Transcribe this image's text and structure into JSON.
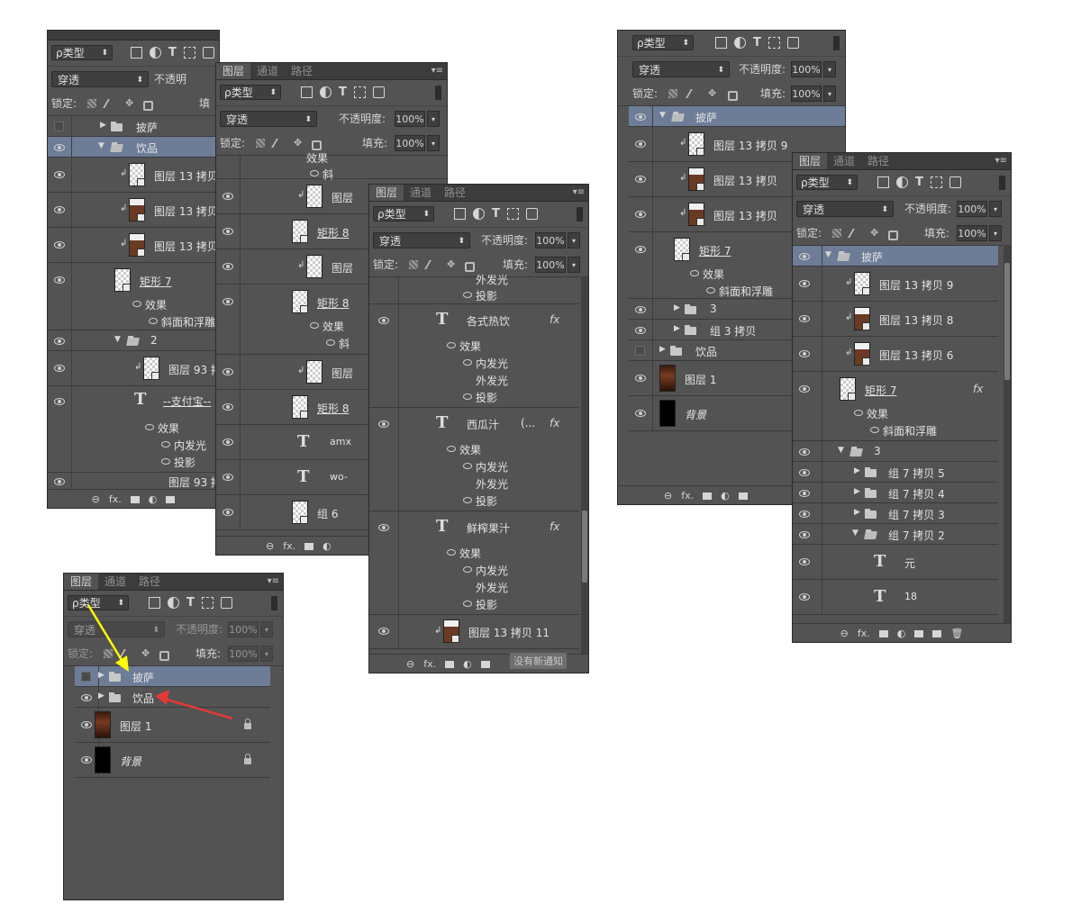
{
  "common": {
    "tab_layers": "图层",
    "tab_channels": "通道",
    "tab_paths": "路径",
    "menu": "▾≡",
    "filter_kind": "ρ类型",
    "blend_mode": "穿透",
    "opacity_label": "不透明度:",
    "opacity_value": "100%",
    "lock_label": "锁定:",
    "fill_label": "填充:",
    "fill_value": "100%",
    "fx": "fx",
    "fx_bottom": "fx."
  },
  "panel1": {
    "opacity_label_cut": "不透明",
    "fill_label_cut": "填",
    "layers": {
      "pizza": "披萨",
      "drinks": "饮品",
      "copy1": "图层 13 拷贝",
      "copy2": "图层 13 拷贝",
      "copy3": "图层 13 拷贝",
      "rect7": "矩形 7",
      "effect": "效果",
      "bevel": "斜面和浮雕",
      "group2": "2",
      "l93": "图层 93 拷",
      "alipay": "--支付宝--",
      "effect2": "效果",
      "inner_glow": "内发光",
      "shadow": "投影",
      "bottom_cut": "图层 93 拷"
    }
  },
  "panel2": {
    "layers": {
      "effect_top": "效果",
      "bevel_top": "斜",
      "l1": "图层",
      "rect8a": "矩形 8",
      "l2": "图层",
      "rect8b": "矩形 8",
      "effect": "效果",
      "bevel": "斜",
      "l3": "图层",
      "rect8c": "矩形 8",
      "amx": "amx",
      "wo": "wo-",
      "group6": "组 6"
    }
  },
  "panel3": {
    "layers": {
      "outer_glow_top": "外发光",
      "shadow_top": "投影",
      "hot_drinks": "各式热饮",
      "effect1": "效果",
      "inner_glow1": "内发光",
      "outer_glow1": "外发光",
      "shadow1": "投影",
      "watermelon": "西瓜汁",
      "watermelon_suffix": "(...",
      "effect2": "效果",
      "inner_glow2": "内发光",
      "outer_glow2": "外发光",
      "shadow2": "投影",
      "fresh_juice": "鲜榨果汁",
      "effect3": "效果",
      "inner_glow3": "内发光",
      "outer_glow3": "外发光",
      "shadow3": "投影",
      "copy11": "图层 13 拷贝 11"
    },
    "notice": "没有新通知"
  },
  "panel4": {
    "layers": {
      "pizza": "披萨",
      "copy9": "图层 13 拷贝 9",
      "copyb": "图层 13 拷贝",
      "copyc": "图层 13 拷贝",
      "rect7": "矩形 7",
      "effect": "效果",
      "bevel": "斜面和浮雕",
      "group3": "3",
      "g3copy": "组 3 拷贝",
      "drinks": "饮品",
      "layer1": "图层 1",
      "background": "背景"
    }
  },
  "panel5": {
    "layers": {
      "pizza": "披萨",
      "copy9": "图层 13 拷贝 9",
      "copy8": "图层 13 拷贝 8",
      "copy6": "图层 13 拷贝 6",
      "rect7": "矩形 7",
      "effect": "效果",
      "bevel": "斜面和浮雕",
      "group3": "3",
      "g7c5": "组 7 拷贝 5",
      "g7c4": "组 7 拷贝 4",
      "g7c3": "组 7 拷贝 3",
      "g7c2": "组 7 拷贝 2",
      "yuan": "元",
      "n18": "18"
    }
  },
  "panel6": {
    "layers": {
      "pizza": "披萨",
      "drinks": "饮品",
      "layer1": "图层 1",
      "background": "背景"
    },
    "arrow_yellow": "#ffff00",
    "arrow_red": "#e53935"
  }
}
